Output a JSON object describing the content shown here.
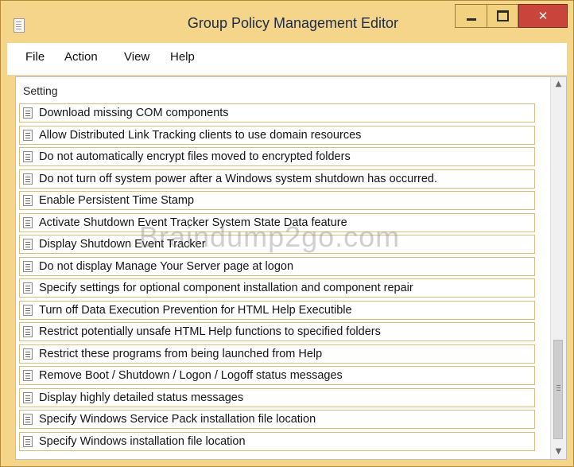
{
  "window": {
    "title": "Group Policy Management Editor",
    "controls": {
      "minimize": "minimize-icon",
      "maximize": "maximize-icon",
      "close": "close-icon"
    },
    "colors": {
      "frame": "#f5d58a",
      "close": "#c9443a"
    }
  },
  "menu": {
    "items": [
      "File",
      "Action",
      "View",
      "Help"
    ]
  },
  "list": {
    "column_header": "Setting",
    "rows": [
      "Download missing COM components",
      "Allow Distributed Link Tracking clients to use domain resources",
      "Do not automatically encrypt files moved to encrypted folders",
      "Do not turn off system power after a Windows system shutdown has occurred.",
      "Enable Persistent Time Stamp",
      "Activate Shutdown Event Tracker System State Data feature",
      "Display Shutdown Event Tracker",
      "Do not display Manage Your Server page at logon",
      "Specify settings for optional component installation and component repair",
      "Turn off Data Execution Prevention for HTML Help Executible",
      "Restrict potentially unsafe HTML Help functions to specified folders",
      "Restrict these programs from being launched from Help",
      "Remove Boot / Shutdown / Logon / Logoff status messages",
      "Display highly detailed status messages",
      "Specify Windows Service Pack installation file location",
      "Specify Windows installation file location"
    ]
  },
  "watermark": "Braindump2go.com"
}
